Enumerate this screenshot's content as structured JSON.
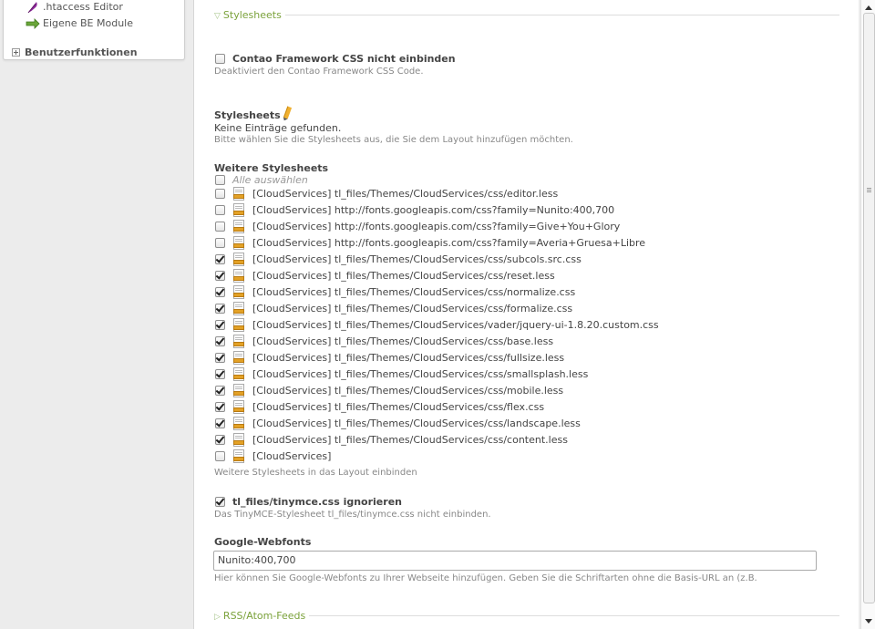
{
  "nav": {
    "items": [
      {
        "label": ".htaccess Editor",
        "icon": "feather-icon"
      },
      {
        "label": "Eigene BE Module",
        "icon": "arrow-right-icon"
      }
    ],
    "group": {
      "label": "Benutzerfunktionen",
      "icon": "plus-icon"
    }
  },
  "sections": {
    "stylesheets_legend": "Stylesheets",
    "rss_legend": "RSS/Atom-Feeds"
  },
  "framework": {
    "label": "Contao Framework CSS nicht einbinden",
    "help": "Deaktiviert den Contao Framework CSS Code.",
    "checked": false
  },
  "stylesheets": {
    "label": "Stylesheets",
    "empty": "Keine Einträge gefunden.",
    "help": "Bitte wählen Sie die Stylesheets aus, die Sie dem Layout hinzufügen möchten."
  },
  "external": {
    "label": "Weitere Stylesheets",
    "select_all": "Alle auswählen",
    "help": "Weitere Stylesheets in das Layout einbinden",
    "items": [
      {
        "label": "[CloudServices] tl_files/Themes/CloudServices/css/editor.less",
        "checked": false
      },
      {
        "label": "[CloudServices] http://fonts.googleapis.com/css?family=Nunito:400,700",
        "checked": false
      },
      {
        "label": "[CloudServices] http://fonts.googleapis.com/css?family=Give+You+Glory",
        "checked": false
      },
      {
        "label": "[CloudServices] http://fonts.googleapis.com/css?family=Averia+Gruesa+Libre",
        "checked": false
      },
      {
        "label": "[CloudServices] tl_files/Themes/CloudServices/css/subcols.src.css",
        "checked": true
      },
      {
        "label": "[CloudServices] tl_files/Themes/CloudServices/css/reset.less",
        "checked": true
      },
      {
        "label": "[CloudServices] tl_files/Themes/CloudServices/css/normalize.css",
        "checked": true
      },
      {
        "label": "[CloudServices] tl_files/Themes/CloudServices/css/formalize.css",
        "checked": true
      },
      {
        "label": "[CloudServices] tl_files/Themes/CloudServices/vader/jquery-ui-1.8.20.custom.css",
        "checked": true
      },
      {
        "label": "[CloudServices] tl_files/Themes/CloudServices/css/base.less",
        "checked": true
      },
      {
        "label": "[CloudServices] tl_files/Themes/CloudServices/css/fullsize.less",
        "checked": true
      },
      {
        "label": "[CloudServices] tl_files/Themes/CloudServices/css/smallsplash.less",
        "checked": true
      },
      {
        "label": "[CloudServices] tl_files/Themes/CloudServices/css/mobile.less",
        "checked": true
      },
      {
        "label": "[CloudServices] tl_files/Themes/CloudServices/css/flex.css",
        "checked": true
      },
      {
        "label": "[CloudServices] tl_files/Themes/CloudServices/css/landscape.less",
        "checked": true
      },
      {
        "label": "[CloudServices] tl_files/Themes/CloudServices/css/content.less",
        "checked": true
      },
      {
        "label": "[CloudServices]",
        "checked": false
      }
    ]
  },
  "tinymce": {
    "label": "tl_files/tinymce.css ignorieren",
    "help": "Das TinyMCE-Stylesheet tl_files/tinymce.css nicht einbinden.",
    "checked": true
  },
  "webfonts": {
    "label": "Google-Webfonts",
    "value": "Nunito:400,700",
    "help": "Hier können Sie Google-Webfonts zu Ihrer Webseite hinzufügen. Geben Sie die Schriftarten ohne die Basis-URL an (z.B."
  },
  "colors": {
    "accent": "#7ba23b",
    "help_text": "#888888"
  }
}
